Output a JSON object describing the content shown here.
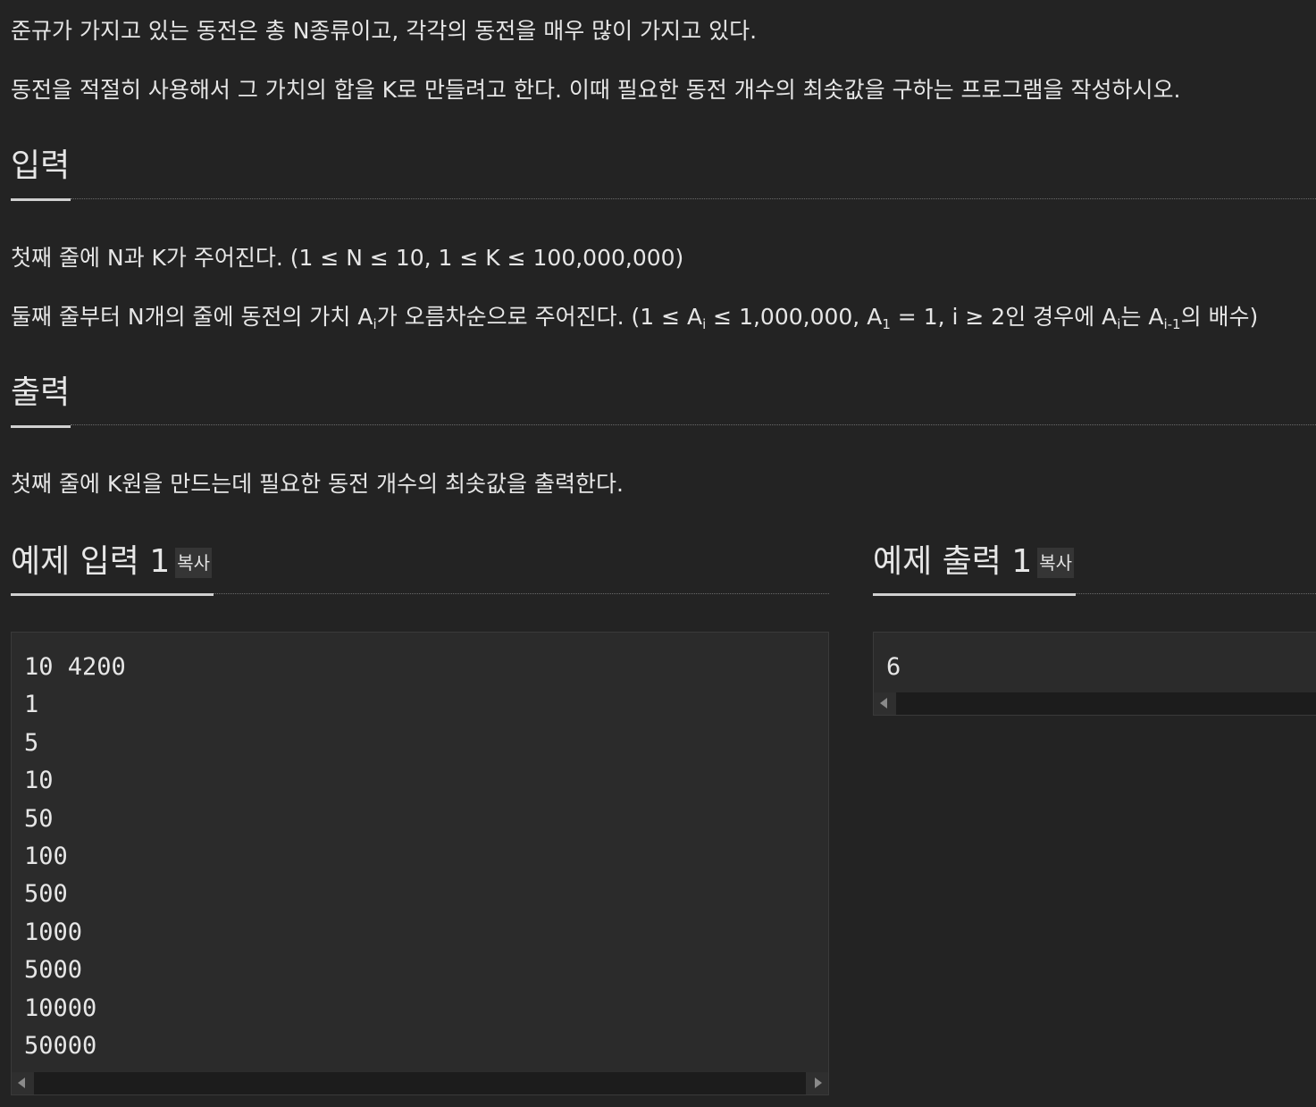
{
  "description": {
    "line1": "준규가 가지고 있는 동전은 총 N종류이고, 각각의 동전을 매우 많이 가지고 있다.",
    "line2": "동전을 적절히 사용해서 그 가치의 합을 K로 만들려고 한다. 이때 필요한 동전 개수의 최솟값을 구하는 프로그램을 작성하시오."
  },
  "input_section": {
    "heading": "입력",
    "line1": "첫째 줄에 N과 K가 주어진다. (1 ≤ N ≤ 10, 1 ≤ K ≤ 100,000,000)",
    "line2": {
      "a": "둘째 줄부터 N개의 줄에 동전의 가치 A",
      "a_sub": "i",
      "b": "가 오름차순으로 주어진다. (1 ≤ A",
      "b_sub": "i",
      "c": " ≤ 1,000,000, A",
      "c_sub": "1",
      "d": " = 1, i ≥ 2인 경우에 A",
      "d_sub": "i",
      "e": "는 A",
      "e_sub": "i-1",
      "f": "의 배수)"
    }
  },
  "output_section": {
    "heading": "출력",
    "line1": "첫째 줄에 K원을 만드는데 필요한 동전 개수의 최솟값을 출력한다."
  },
  "sample_input": {
    "title": "예제 입력 1",
    "copy_label": "복사",
    "lines": [
      "10 4200",
      "1",
      "5",
      "10",
      "50",
      "100",
      "500",
      "1000",
      "5000",
      "10000",
      "50000"
    ]
  },
  "sample_output": {
    "title": "예제 출력 1",
    "copy_label": "복사",
    "lines": [
      "6"
    ]
  }
}
